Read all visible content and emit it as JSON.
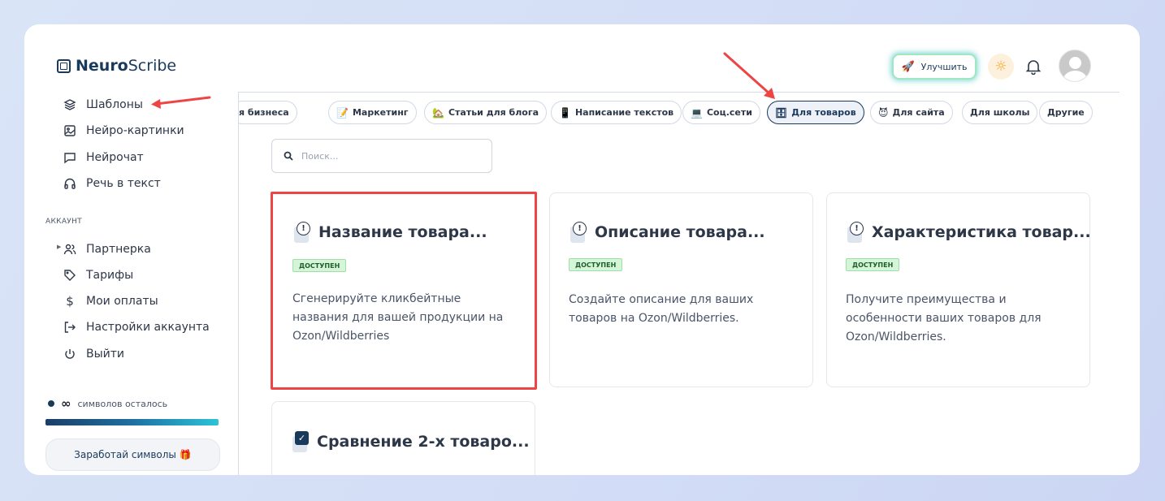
{
  "app": {
    "logo_bold": "Neuro",
    "logo_rest": "Scribe"
  },
  "header": {
    "upgrade_label": "Улучшить"
  },
  "sidebar": {
    "items": [
      {
        "label": "Шаблоны",
        "icon": "layers-icon"
      },
      {
        "label": "Нейро-картинки",
        "icon": "image-icon"
      },
      {
        "label": "Нейрочат",
        "icon": "chat-icon"
      },
      {
        "label": "Речь в текст",
        "icon": "headphones-icon"
      }
    ],
    "section_label": "АККАУНТ",
    "account_items": [
      {
        "label": "Партнерка",
        "icon": "users-icon"
      },
      {
        "label": "Тарифы",
        "icon": "tag-icon"
      },
      {
        "label": "Мои оплаты",
        "icon": "dollar-icon"
      },
      {
        "label": "Настройки аккаунта",
        "icon": "logout-arrow-icon"
      },
      {
        "label": "Выйти",
        "icon": "power-icon"
      }
    ],
    "symbols_value": "∞",
    "symbols_text": "символов осталось",
    "earn_label": "Заработай символы",
    "earn_emoji": "🎁"
  },
  "categories": [
    {
      "label": "я бизнеса",
      "emoji": ""
    },
    {
      "label": "Маркетинг",
      "emoji": "📝"
    },
    {
      "label": "Статьи для блога",
      "emoji": "🏡"
    },
    {
      "label": "Написание текстов",
      "emoji": "📱"
    },
    {
      "label": "Соц.сети",
      "emoji": "💻"
    },
    {
      "label": "Для товаров",
      "emoji": "🗄",
      "active": true
    },
    {
      "label": "Для сайта",
      "emoji": "😈"
    },
    {
      "label": "Для школы",
      "emoji": ""
    },
    {
      "label": "Другие",
      "emoji": ""
    }
  ],
  "search": {
    "placeholder": "Поиск..."
  },
  "cards": [
    {
      "title": "Название товара...",
      "badge": "ДОСТУПЕН",
      "description": "Сгенерируйте кликбейтные названия для вашей продукции на Ozon/Wildberries",
      "icon": "info-doc-icon"
    },
    {
      "title": "Описание товара...",
      "badge": "ДОСТУПЕН",
      "description": "Создайте описание для ваших товаров на Ozon/Wildberries.",
      "icon": "info-doc-icon"
    },
    {
      "title": "Характеристика товар...",
      "badge": "ДОСТУПЕН",
      "description": "Получите преимущества и особенности ваших товаров для Ozon/Wildberries.",
      "icon": "info-doc-icon"
    },
    {
      "title": "Сравнение 2-х товаро...",
      "badge": "",
      "description": "",
      "icon": "check-doc-icon"
    }
  ],
  "colors": {
    "accent": "#1a3a5c",
    "annotation": "#ef4444",
    "badge_bg": "#d4f5d8"
  }
}
